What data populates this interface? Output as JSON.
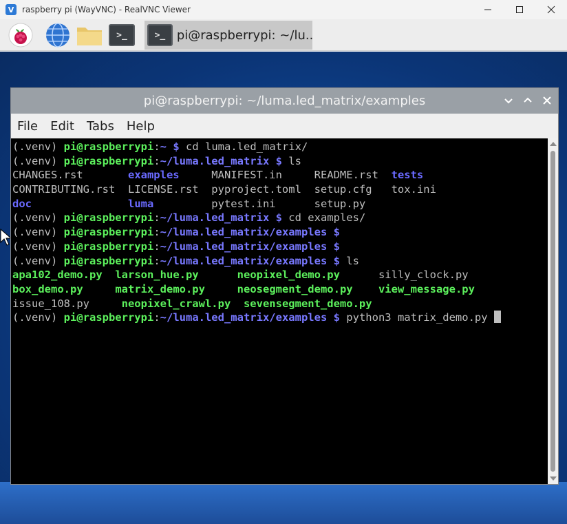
{
  "host_window": {
    "title": "raspberry pi (WayVNC) - RealVNC Viewer",
    "icon": "realvnc-icon",
    "controls": [
      "minimize-icon",
      "maximize-icon",
      "close-icon"
    ]
  },
  "taskbar": {
    "items": [
      "raspberry-pi-menu-icon",
      "web-browser-icon",
      "file-manager-icon",
      "terminal-icon"
    ],
    "active_task_label": "pi@raspberrypi: ~/lu..."
  },
  "terminal": {
    "title": "pi@raspberrypi: ~/luma.led_matrix/examples",
    "menu": [
      "File",
      "Edit",
      "Tabs",
      "Help"
    ],
    "lines": [
      [
        [
          "(.venv) ",
          "venv"
        ],
        [
          "pi@raspberrypi",
          "host"
        ],
        [
          ":",
          "sep"
        ],
        [
          "~",
          "path"
        ],
        [
          " $ ",
          "dollar"
        ],
        [
          "cd luma.led_matrix/",
          "cmd"
        ]
      ],
      [
        [
          "(.venv) ",
          "venv"
        ],
        [
          "pi@raspberrypi",
          "host"
        ],
        [
          ":",
          "sep"
        ],
        [
          "~/luma.led_matrix",
          "path"
        ],
        [
          " $ ",
          "dollar"
        ],
        [
          "ls",
          "cmd"
        ]
      ],
      [
        [
          "CHANGES.rst       ",
          "file"
        ],
        [
          "examples",
          "dir"
        ],
        [
          "     MANIFEST.in     README.rst  ",
          "file"
        ],
        [
          "tests",
          "dir"
        ]
      ],
      [
        [
          "CONTRIBUTING.rst  LICENSE.rst  pyproject.toml  setup.cfg   tox.ini",
          "file"
        ]
      ],
      [
        [
          "doc",
          "dir"
        ],
        [
          "               ",
          "file"
        ],
        [
          "luma",
          "dir"
        ],
        [
          "         pytest.ini      setup.py",
          "file"
        ]
      ],
      [
        [
          "(.venv) ",
          "venv"
        ],
        [
          "pi@raspberrypi",
          "host"
        ],
        [
          ":",
          "sep"
        ],
        [
          "~/luma.led_matrix",
          "path"
        ],
        [
          " $ ",
          "dollar"
        ],
        [
          "cd examples/",
          "cmd"
        ]
      ],
      [
        [
          "(.venv) ",
          "venv"
        ],
        [
          "pi@raspberrypi",
          "host"
        ],
        [
          ":",
          "sep"
        ],
        [
          "~/luma.led_matrix/examples",
          "path"
        ],
        [
          " $",
          "dollar"
        ]
      ],
      [
        [
          "(.venv) ",
          "venv"
        ],
        [
          "pi@raspberrypi",
          "host"
        ],
        [
          ":",
          "sep"
        ],
        [
          "~/luma.led_matrix/examples",
          "path"
        ],
        [
          " $",
          "dollar"
        ]
      ],
      [
        [
          "(.venv) ",
          "venv"
        ],
        [
          "pi@raspberrypi",
          "host"
        ],
        [
          ":",
          "sep"
        ],
        [
          "~/luma.led_matrix/examples",
          "path"
        ],
        [
          " $ ",
          "dollar"
        ],
        [
          "ls",
          "cmd"
        ]
      ],
      [
        [
          "apa102_demo.py",
          "exe"
        ],
        [
          "  ",
          "file"
        ],
        [
          "larson_hue.py",
          "exe"
        ],
        [
          "      ",
          "file"
        ],
        [
          "neopixel_demo.py",
          "exe"
        ],
        [
          "      silly_clock.py",
          "file"
        ]
      ],
      [
        [
          "box_demo.py",
          "exe"
        ],
        [
          "     ",
          "file"
        ],
        [
          "matrix_demo.py",
          "exe"
        ],
        [
          "     ",
          "file"
        ],
        [
          "neosegment_demo.py",
          "exe"
        ],
        [
          "    ",
          "file"
        ],
        [
          "view_message.py",
          "exe"
        ]
      ],
      [
        [
          "issue_108.py     ",
          "file"
        ],
        [
          "neopixel_crawl.py",
          "exe"
        ],
        [
          "  ",
          "file"
        ],
        [
          "sevensegment_demo.py",
          "exe"
        ]
      ],
      [
        [
          "(.venv) ",
          "venv"
        ],
        [
          "pi@raspberrypi",
          "host"
        ],
        [
          ":",
          "sep"
        ],
        [
          "~/luma.led_matrix/examples",
          "path"
        ],
        [
          " $ ",
          "dollar"
        ],
        [
          "python3 matrix_demo.py ",
          "cmd"
        ]
      ]
    ]
  },
  "colors": {
    "prompt_user": "#5cf05c",
    "prompt_path": "#7878ff",
    "directory": "#6a6aff",
    "executable": "#5cf05c",
    "plain_text": "#bebebe",
    "terminal_bg": "#000000",
    "desktop": "#124a9a"
  }
}
